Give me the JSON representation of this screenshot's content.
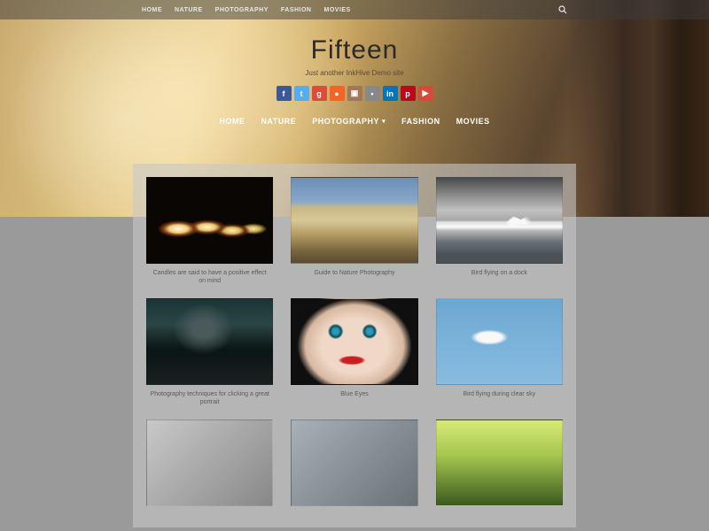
{
  "topnav": [
    "HOME",
    "NATURE",
    "PHOTOGRAPHY",
    "FASHION",
    "MOVIES"
  ],
  "site": {
    "title": "Fifteen",
    "tagline": "Just another InkHive Demo site"
  },
  "social": [
    {
      "name": "facebook",
      "glyph": "f",
      "bg": "#3b5998"
    },
    {
      "name": "twitter",
      "glyph": "t",
      "bg": "#55acee"
    },
    {
      "name": "google",
      "glyph": "g",
      "bg": "#dd4b39"
    },
    {
      "name": "rss",
      "glyph": "●",
      "bg": "#f26522"
    },
    {
      "name": "instagram",
      "glyph": "▣",
      "bg": "#a07858"
    },
    {
      "name": "flickr",
      "glyph": "•",
      "bg": "#888888"
    },
    {
      "name": "linkedin",
      "glyph": "in",
      "bg": "#0077b5"
    },
    {
      "name": "pinterest",
      "glyph": "p",
      "bg": "#bd081c"
    },
    {
      "name": "youtube",
      "glyph": "▶",
      "bg": "#d84a38"
    }
  ],
  "mainnav": [
    {
      "label": "HOME",
      "dropdown": false
    },
    {
      "label": "NATURE",
      "dropdown": false
    },
    {
      "label": "PHOTOGRAPHY",
      "dropdown": true
    },
    {
      "label": "FASHION",
      "dropdown": false
    },
    {
      "label": "MOVIES",
      "dropdown": false
    }
  ],
  "posts": [
    {
      "caption": "Candles are said to have a positive effect on mind",
      "thumb": "th-candles"
    },
    {
      "caption": "Guide to Nature Photography",
      "thumb": "th-nature"
    },
    {
      "caption": "Bird flying on a dock",
      "thumb": "th-bird"
    },
    {
      "caption": "Photography techniques for clicking a great portrait",
      "thumb": "th-man"
    },
    {
      "caption": "Blue Eyes",
      "thumb": "th-eyes"
    },
    {
      "caption": "Bird flying during clear sky",
      "thumb": "th-sky"
    },
    {
      "caption": "",
      "thumb": "th-a"
    },
    {
      "caption": "",
      "thumb": "th-b"
    },
    {
      "caption": "",
      "thumb": "th-c"
    }
  ]
}
